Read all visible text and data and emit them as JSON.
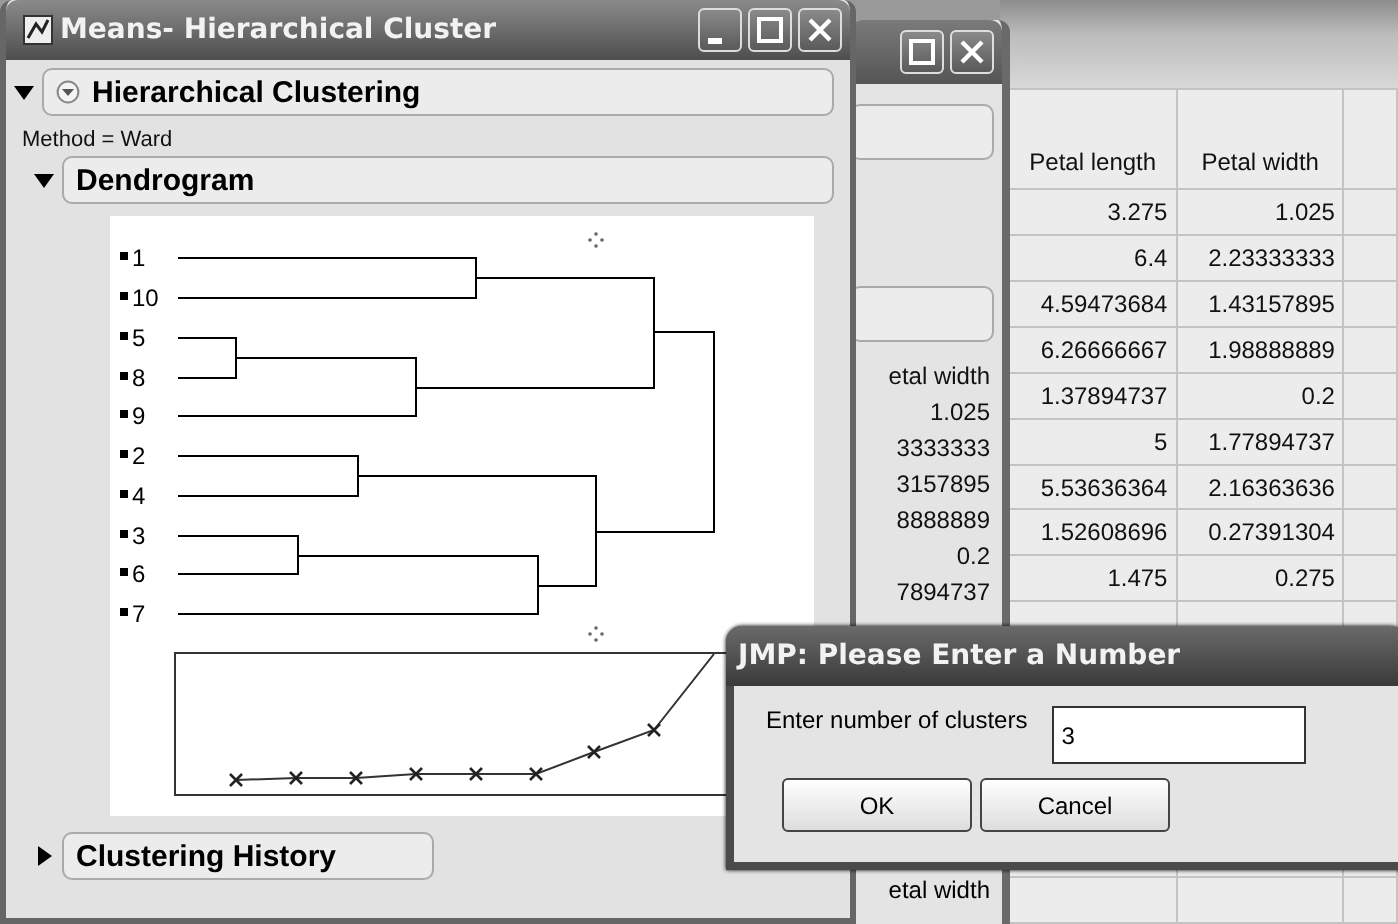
{
  "back_window": {
    "table": {
      "columns": [
        "Petal length",
        "Petal width"
      ],
      "rows": [
        [
          "3.275",
          "1.025"
        ],
        [
          "6.4",
          "2.23333333"
        ],
        [
          "4.59473684",
          "1.43157895"
        ],
        [
          "6.26666667",
          "1.98888889"
        ],
        [
          "1.37894737",
          "0.2"
        ],
        [
          "5",
          "1.77894737"
        ],
        [
          "5.53636364",
          "2.16363636"
        ],
        [
          "1.52608696",
          "0.27391304"
        ],
        [
          "1.475",
          "0.275"
        ]
      ]
    }
  },
  "middle_window": {
    "column_heading": "etal width",
    "values": [
      "1.025",
      "3333333",
      "3157895",
      "8888889",
      "0.2",
      "7894737"
    ],
    "lower_heading": "etal width"
  },
  "front_window": {
    "title": "Means- Hierarchical Cluster",
    "report": {
      "title": "Hierarchical Clustering",
      "expanded": true,
      "method": "Method = Ward",
      "sections": [
        {
          "title": "Dendrogram",
          "expanded": true
        },
        {
          "title": "Clustering History",
          "expanded": false
        }
      ],
      "leaves": [
        "1",
        "10",
        "5",
        "8",
        "9",
        "2",
        "4",
        "3",
        "6",
        "7"
      ]
    }
  },
  "dialog": {
    "title": "JMP: Please Enter a Number",
    "prompt": "Enter number of clusters",
    "value": "3",
    "buttons": [
      "OK",
      "Cancel"
    ]
  }
}
